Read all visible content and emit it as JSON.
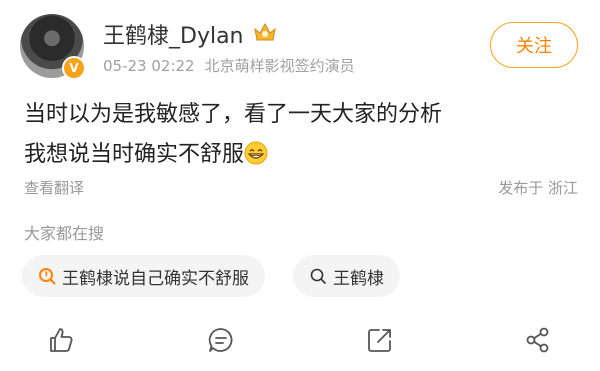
{
  "user": {
    "name": "王鹤棣_Dylan",
    "verified_mark": "V",
    "time": "05-23 02:22",
    "title": "北京萌样影视签约演员",
    "follow_label": "关注"
  },
  "post": {
    "line1": "当时以为是我敏感了，看了一天大家的分析",
    "line2": "我想说当时确实不舒服"
  },
  "footer": {
    "translate": "查看翻译",
    "location": "发布于 浙江"
  },
  "search": {
    "heading": "大家都在搜",
    "chips": [
      {
        "label": "王鹤棣说自己确实不舒服",
        "icon": "hot-search-icon"
      },
      {
        "label": "王鹤棣",
        "icon": "search-icon"
      }
    ]
  },
  "actions": [
    "like-icon",
    "comment-icon",
    "repost-icon",
    "share-icon"
  ],
  "colors": {
    "accent": "#ff8200",
    "border": "#f5a623",
    "muted": "#999999",
    "chip_bg": "#f4f4f4"
  }
}
